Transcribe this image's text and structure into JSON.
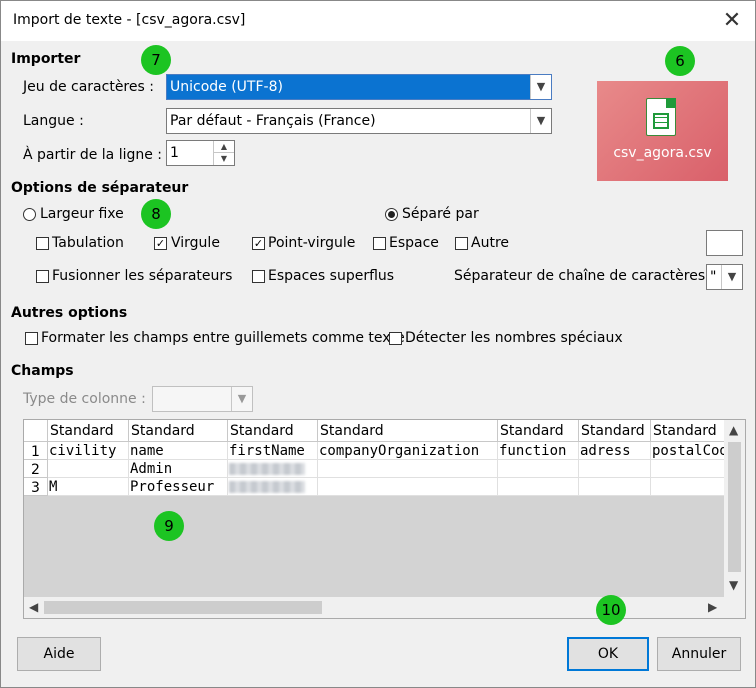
{
  "window": {
    "title": "Import de texte - [csv_agora.csv]",
    "close_glyph": "✕"
  },
  "importer": {
    "section": "Importer",
    "charset_label": "Jeu de caractères :",
    "charset_value": "Unicode (UTF-8)",
    "language_label": "Langue :",
    "language_value": "Par défaut - Français (France)",
    "fromrow_label": "À partir de la ligne :",
    "fromrow_value": "1"
  },
  "preview_file": {
    "name": "csv_agora.csv",
    "icon": "spreadsheet-file-icon"
  },
  "separator": {
    "section": "Options de séparateur",
    "fixed_width": "Largeur fixe",
    "separated_by": "Séparé par",
    "tab": "Tabulation",
    "comma": "Virgule",
    "semicolon": "Point-virgule",
    "space": "Espace",
    "other": "Autre",
    "merge": "Fusionner les séparateurs",
    "trim": "Espaces superflus",
    "string_delim_label": "Séparateur de chaîne de caractères :",
    "string_delim_value": "\"",
    "checked": {
      "tab": false,
      "comma": true,
      "semicolon": true,
      "space": false,
      "other": false,
      "merge": false,
      "trim": false
    },
    "mode": "separated"
  },
  "other_options": {
    "section": "Autres options",
    "quoted_as_text": "Formater les champs entre guillemets comme texte",
    "special_numbers": "Détecter les nombres spéciaux"
  },
  "fields": {
    "section": "Champs",
    "column_type_label": "Type de colonne :",
    "column_type_value": "",
    "headers": [
      "Standard",
      "Standard",
      "Standard",
      "Standard",
      "Standard",
      "Standard",
      "Standard"
    ],
    "row_numbers": [
      "1",
      "2",
      "3"
    ],
    "rows": [
      [
        "civility",
        "name",
        "firstName",
        "companyOrganization",
        "function",
        "adress",
        "postalCode"
      ],
      [
        "",
        "Admin",
        "",
        "",
        "",
        "",
        ""
      ],
      [
        "M",
        "Professeur",
        "",
        "",
        "",
        "",
        ""
      ]
    ]
  },
  "badges": [
    "7",
    "6",
    "8",
    "9",
    "10"
  ],
  "buttons": {
    "help": "Aide",
    "ok": "OK",
    "cancel": "Annuler"
  },
  "colors": {
    "selection": "#0b73d1",
    "badge": "#1cc422",
    "default_button_border": "#0078d7"
  }
}
